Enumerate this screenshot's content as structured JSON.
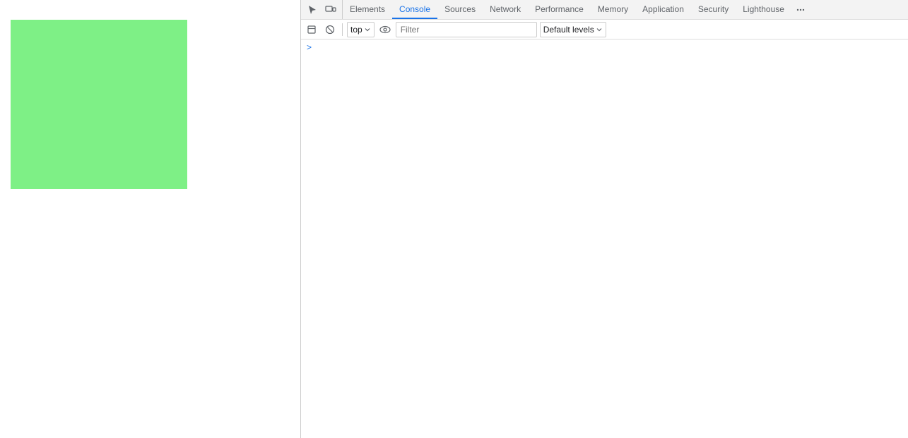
{
  "page": {
    "green_box_color": "#7ef086"
  },
  "devtools": {
    "tabs": [
      {
        "label": "Elements",
        "active": false
      },
      {
        "label": "Console",
        "active": true
      },
      {
        "label": "Sources",
        "active": false
      },
      {
        "label": "Network",
        "active": false
      },
      {
        "label": "Performance",
        "active": false
      },
      {
        "label": "Memory",
        "active": false
      },
      {
        "label": "Application",
        "active": false
      },
      {
        "label": "Security",
        "active": false
      },
      {
        "label": "Lighthouse",
        "active": false
      }
    ],
    "console_toolbar": {
      "context": "top",
      "filter_placeholder": "Filter",
      "levels_label": "Default levels"
    },
    "prompt_symbol": ">"
  }
}
